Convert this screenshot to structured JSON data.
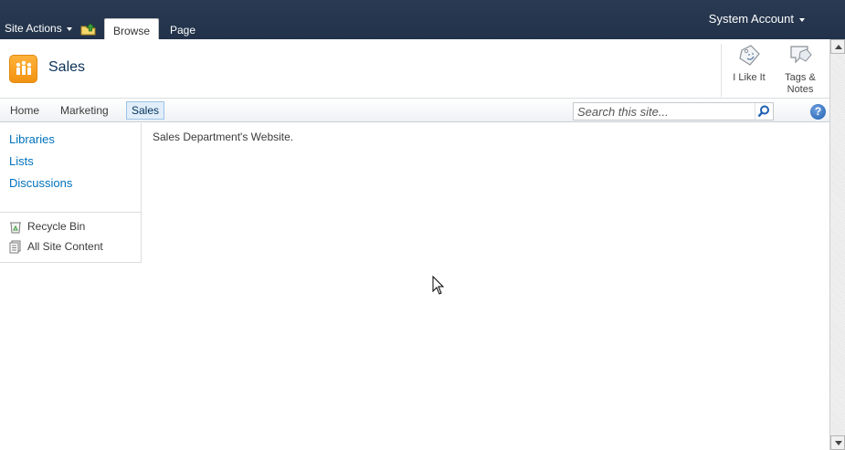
{
  "ribbon": {
    "site_actions_label": "Site Actions",
    "tabs": [
      {
        "label": "Browse",
        "selected": true
      },
      {
        "label": "Page",
        "selected": false
      }
    ],
    "user_label": "System Account"
  },
  "title_area": {
    "site_title": "Sales",
    "logo_icon": "people-icon",
    "social": [
      {
        "label": "I Like It",
        "icon": "like-tag-icon"
      },
      {
        "label_line1": "Tags &",
        "label_line2": "Notes",
        "icon": "tags-notes-icon"
      }
    ]
  },
  "topnav": {
    "items": [
      {
        "label": "Home",
        "selected": false
      },
      {
        "label": "Marketing",
        "selected": false
      },
      {
        "label": "Sales",
        "selected": true
      }
    ],
    "search": {
      "placeholder": "Search this site...",
      "value": ""
    },
    "help_label": "?"
  },
  "leftnav": {
    "quick_launch": [
      {
        "label": "Libraries"
      },
      {
        "label": "Lists"
      },
      {
        "label": "Discussions"
      }
    ],
    "special": [
      {
        "label": "Recycle Bin",
        "icon": "recycle-bin-icon"
      },
      {
        "label": "All Site Content",
        "icon": "site-content-icon"
      }
    ]
  },
  "main": {
    "description": "Sales Department's Website."
  },
  "colors": {
    "ribbon_bg": "#21324a",
    "link": "#0072bc",
    "logo": "#f29312",
    "selected_nav_bg": "#e1eef9"
  }
}
